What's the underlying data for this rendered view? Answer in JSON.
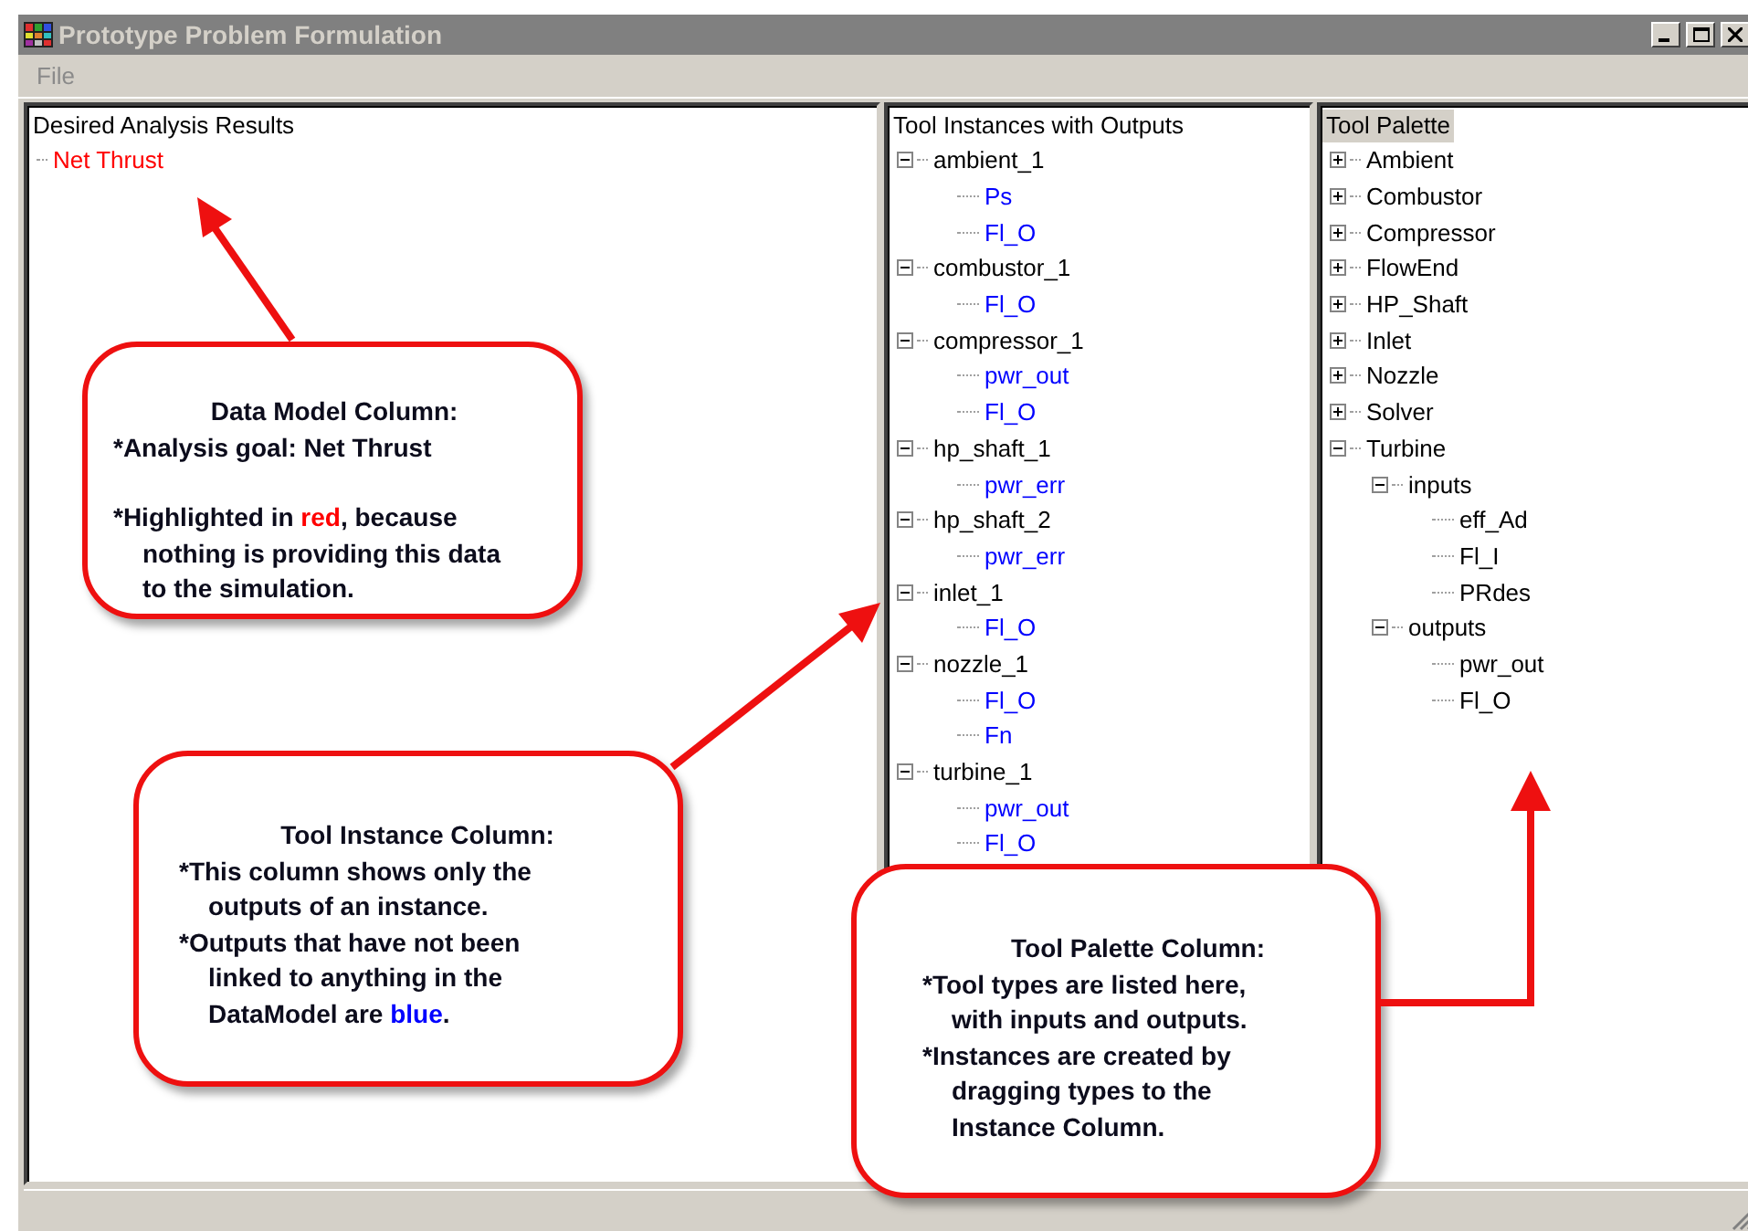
{
  "window": {
    "title": "Prototype Problem Formulation"
  },
  "menu": [
    {
      "label": "File",
      "disabled": true
    }
  ],
  "data_model": {
    "title": "Desired Analysis Results",
    "items": [
      {
        "label": "Net Thrust",
        "linked": false
      }
    ]
  },
  "instances": {
    "title": "Tool Instances with Outputs",
    "items": [
      {
        "label": "ambient_1",
        "expanded": true,
        "children": [
          {
            "label": "Ps",
            "linked": false
          },
          {
            "label": "Fl_O",
            "linked": false
          }
        ]
      },
      {
        "label": "combustor_1",
        "expanded": true,
        "children": [
          {
            "label": "Fl_O",
            "linked": false
          }
        ]
      },
      {
        "label": "compressor_1",
        "expanded": true,
        "children": [
          {
            "label": "pwr_out",
            "linked": false
          },
          {
            "label": "Fl_O",
            "linked": false
          }
        ]
      },
      {
        "label": "hp_shaft_1",
        "expanded": true,
        "children": [
          {
            "label": "pwr_err",
            "linked": false
          }
        ]
      },
      {
        "label": "hp_shaft_2",
        "expanded": true,
        "children": [
          {
            "label": "pwr_err",
            "linked": false
          }
        ]
      },
      {
        "label": "inlet_1",
        "expanded": true,
        "children": [
          {
            "label": "Fl_O",
            "linked": false
          }
        ]
      },
      {
        "label": "nozzle_1",
        "expanded": true,
        "children": [
          {
            "label": "Fl_O",
            "linked": false
          },
          {
            "label": "Fn",
            "linked": false
          }
        ]
      },
      {
        "label": "turbine_1",
        "expanded": true,
        "children": [
          {
            "label": "pwr_out",
            "linked": false
          },
          {
            "label": "Fl_O",
            "linked": false
          }
        ]
      }
    ]
  },
  "palette": {
    "title": "Tool Palette",
    "title_selected": true,
    "items": [
      {
        "label": "Ambient",
        "expanded": false
      },
      {
        "label": "Combustor",
        "expanded": false
      },
      {
        "label": "Compressor",
        "expanded": false
      },
      {
        "label": "FlowEnd",
        "expanded": false
      },
      {
        "label": "HP_Shaft",
        "expanded": false
      },
      {
        "label": "Inlet",
        "expanded": false
      },
      {
        "label": "Nozzle",
        "expanded": false
      },
      {
        "label": "Solver",
        "expanded": false
      },
      {
        "label": "Turbine",
        "expanded": true,
        "children": [
          {
            "label": "inputs",
            "expanded": true,
            "children": [
              {
                "label": "eff_Ad"
              },
              {
                "label": "Fl_I"
              },
              {
                "label": "PRdes"
              }
            ]
          },
          {
            "label": "outputs",
            "expanded": true,
            "children": [
              {
                "label": "pwr_out"
              },
              {
                "label": "Fl_O"
              }
            ]
          }
        ]
      }
    ]
  },
  "callouts": [
    {
      "heading": "Data Model Column:",
      "points": [
        {
          "lines": [
            "*Analysis goal:  Net Thrust"
          ]
        },
        {
          "lines": [
            {
              "parts": [
                {
                  "text": "*Highlighted in "
                },
                {
                  "text": "red",
                  "color": "#ff0000"
                },
                {
                  "text": ", because"
                }
              ]
            },
            "nothing is providing this data",
            "to the simulation."
          ]
        }
      ]
    },
    {
      "heading": "Tool Instance Column:",
      "points": [
        {
          "lines": [
            "*This column shows only the",
            "outputs of an instance."
          ]
        },
        {
          "lines": [
            "*Outputs that have not been",
            "linked to anything in the",
            {
              "parts": [
                {
                  "text": "DataModel are "
                },
                {
                  "text": "blue",
                  "color": "#0000ff"
                },
                {
                  "text": "."
                }
              ]
            }
          ]
        }
      ]
    },
    {
      "heading": "Tool Palette Column:",
      "points": [
        {
          "lines": [
            "*Tool types are listed here,",
            "with inputs and outputs."
          ]
        },
        {
          "lines": [
            "*Instances are created by",
            "dragging types to the",
            "Instance Column."
          ]
        }
      ]
    }
  ]
}
